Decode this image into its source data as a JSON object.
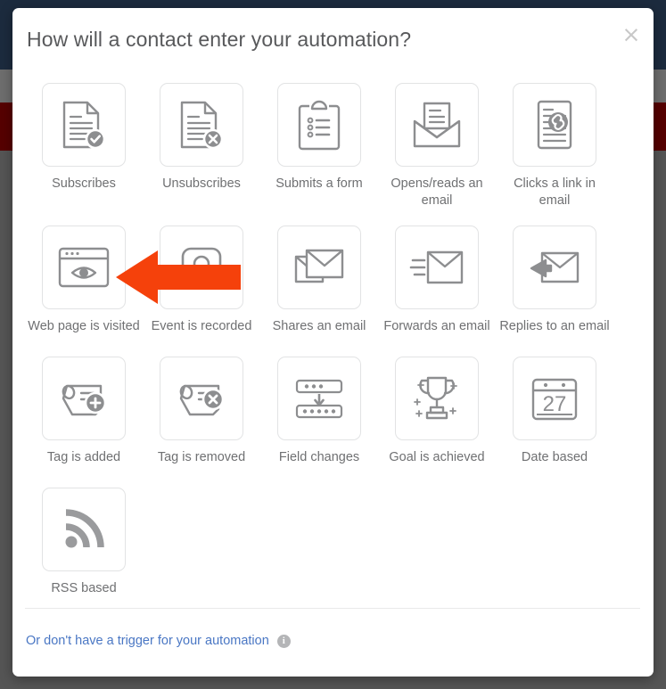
{
  "backdrop": {
    "navy_color": "#1c2b3e",
    "red_color": "#560000",
    "overlay_color": "#6b6b6b"
  },
  "modal": {
    "title": "How will a contact enter your automation?",
    "close_label": "×",
    "close_icon": "close-icon"
  },
  "annotation": {
    "arrow_icon": "left-arrow-annotation",
    "arrow_color": "#f5410b",
    "points_at": "Web page is visited"
  },
  "triggers": {
    "rows": [
      [
        {
          "label": "Subscribes",
          "icon": "document-check-icon"
        },
        {
          "label": "Unsubscribes",
          "icon": "document-x-icon"
        },
        {
          "label": "Submits a form",
          "icon": "clipboard-list-icon"
        },
        {
          "label": "Opens/reads an email",
          "icon": "open-envelope-icon"
        },
        {
          "label": "Clicks a link in email",
          "icon": "document-link-icon"
        }
      ],
      [
        {
          "label": "Web page is visited",
          "icon": "browser-eye-icon"
        },
        {
          "label": "Event is recorded",
          "icon": "event-record-icon"
        },
        {
          "label": "Shares an email",
          "icon": "stacked-envelopes-icon"
        },
        {
          "label": "Forwards an email",
          "icon": "envelope-forward-icon"
        },
        {
          "label": "Replies to an email",
          "icon": "envelope-reply-icon"
        }
      ],
      [
        {
          "label": "Tag is added",
          "icon": "tag-plus-icon"
        },
        {
          "label": "Tag is removed",
          "icon": "tag-x-icon"
        },
        {
          "label": "Field changes",
          "icon": "field-change-icon"
        },
        {
          "label": "Goal is achieved",
          "icon": "trophy-icon"
        },
        {
          "label": "Date based",
          "icon": "calendar-icon",
          "day": "27"
        }
      ],
      [
        {
          "label": "RSS based",
          "icon": "rss-icon"
        }
      ]
    ]
  },
  "footer": {
    "no_trigger_text": "Or don't have a trigger for your automation",
    "info_icon": "info-icon",
    "info_label": "i"
  }
}
